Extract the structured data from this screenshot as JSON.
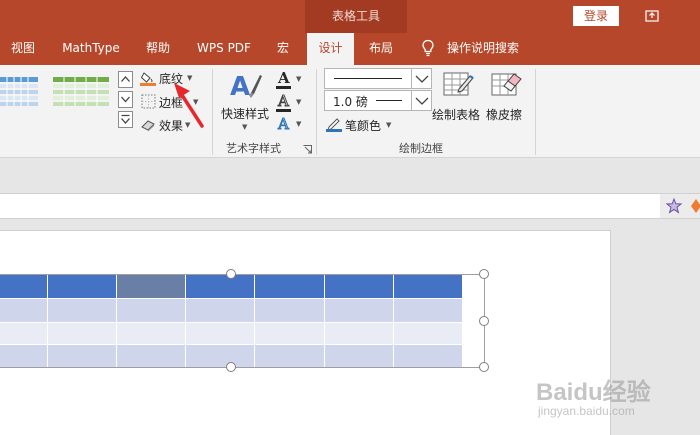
{
  "titlebar": {
    "context_tab_group": "表格工具",
    "login_label": "登录"
  },
  "tabs": [
    {
      "label": "视图"
    },
    {
      "label": "MathType"
    },
    {
      "label": "帮助"
    },
    {
      "label": "WPS PDF"
    },
    {
      "label": "宏"
    },
    {
      "label": "设计",
      "active": true
    },
    {
      "label": "布局"
    }
  ],
  "tell_me": "操作说明搜索",
  "ribbon": {
    "table_styles": {
      "shading": "底纹",
      "borders": "边框",
      "effects": "效果"
    },
    "wordart": {
      "quick_styles": "快速样式",
      "group_label": "艺术字样式"
    },
    "draw_borders": {
      "pen_weight": "1.0 磅",
      "pen_color": "笔颜色",
      "draw_table": "绘制表格",
      "eraser": "橡皮擦",
      "group_label": "绘制边框"
    }
  },
  "colors": {
    "titlebar": "#b7472a",
    "header_row": "#4472c4",
    "row_dark": "#cfd5ea",
    "row_light": "#e9ebf5"
  },
  "watermark": {
    "brand": "Baidu经验",
    "url": "jingyan.baidu.com"
  }
}
